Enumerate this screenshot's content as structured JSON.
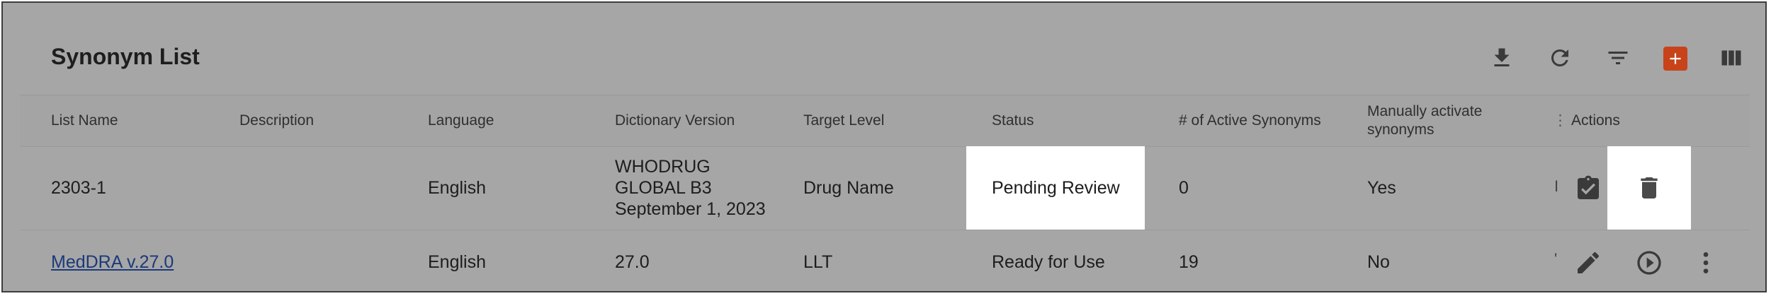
{
  "title": "Synonym List",
  "toolbar": {
    "icons": [
      "download-icon",
      "refresh-icon",
      "filter-icon",
      "add-icon",
      "columns-icon"
    ],
    "accent": "#c8431a"
  },
  "columns": {
    "list_name": "List Name",
    "description": "Description",
    "language": "Language",
    "dictionary_version": "Dictionary Version",
    "target_level": "Target Level",
    "status": "Status",
    "active_synonyms": "# of Active Synonyms",
    "manually_activate_1": "Manually activate",
    "manually_activate_2": "synonyms",
    "truncated": "",
    "actions": "Actions"
  },
  "rows": [
    {
      "list_name": "2303-1",
      "description": "",
      "language": "English",
      "dictionary_version_1": "WHODRUG",
      "dictionary_version_2": "GLOBAL B3",
      "dictionary_version_3": "September 1, 2023",
      "target_level": "Drug Name",
      "status": "Pending Review",
      "active_synonyms": "0",
      "manually_activate": "Yes",
      "truncated": "I",
      "actions": [
        "review-icon",
        "delete-icon"
      ]
    },
    {
      "list_name": "MedDRA v.27.0",
      "description": "",
      "language": "English",
      "dictionary_version": "27.0",
      "target_level": "LLT",
      "status": "Ready for Use",
      "active_synonyms": "19",
      "manually_activate": "No",
      "truncated": "'",
      "actions": [
        "edit-icon",
        "play-icon",
        "more-vert-icon"
      ]
    }
  ]
}
